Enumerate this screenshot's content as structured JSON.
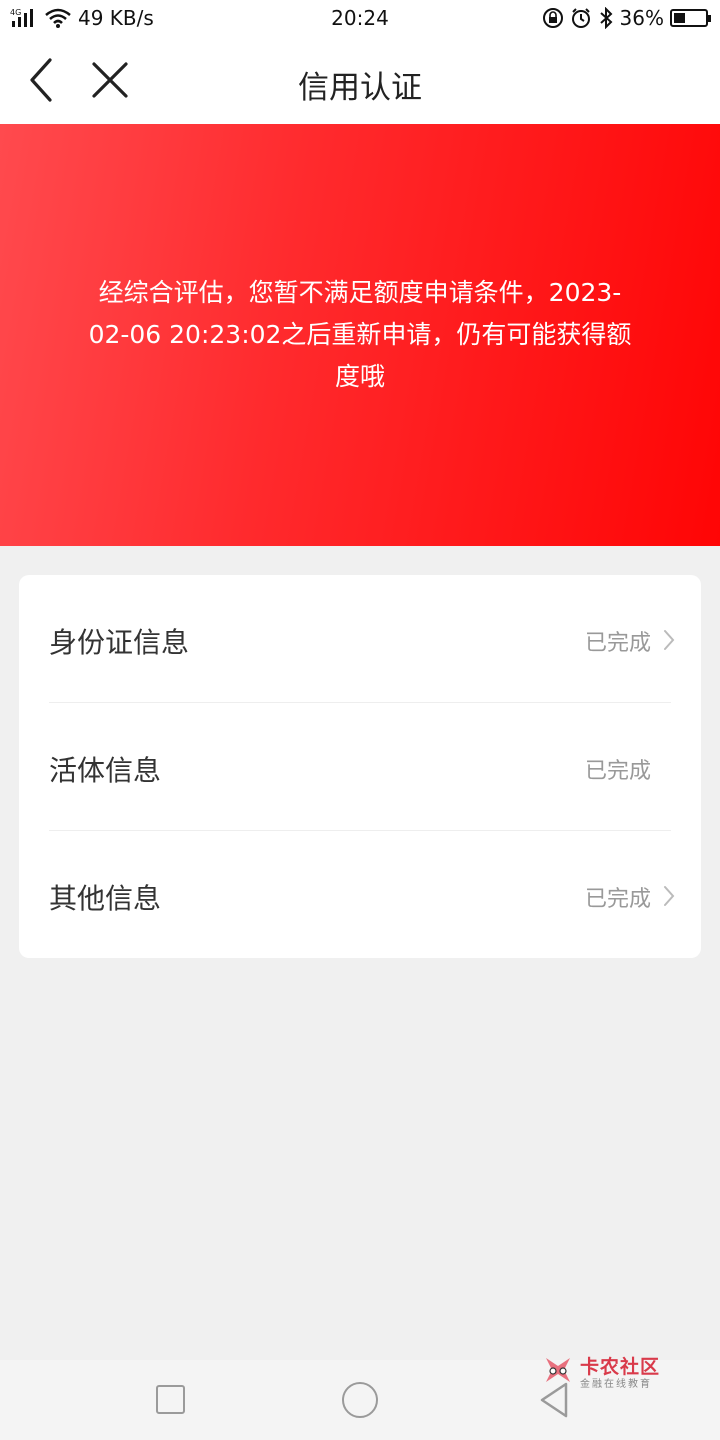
{
  "status_bar": {
    "network": "4G",
    "speed": "49 KB/s",
    "time": "20:24",
    "battery": "36%",
    "battery_level": 0.36
  },
  "header": {
    "title": "信用认证",
    "back_icon": "chevron-left-icon",
    "close_icon": "close-icon"
  },
  "banner": {
    "message": "经综合评估，您暂不满足额度申请条件，2023-02-06 20:23:02之后重新申请，仍有可能获得额度哦",
    "color_start": "#ff4a4e",
    "color_end": "#ff0505"
  },
  "items": [
    {
      "label": "身份证信息",
      "status": "已完成",
      "chevron": true
    },
    {
      "label": "活体信息",
      "status": "已完成",
      "chevron": false
    },
    {
      "label": "其他信息",
      "status": "已完成",
      "chevron": true
    }
  ],
  "watermark": {
    "name": "卡农社区",
    "tagline": "金融在线教育"
  }
}
